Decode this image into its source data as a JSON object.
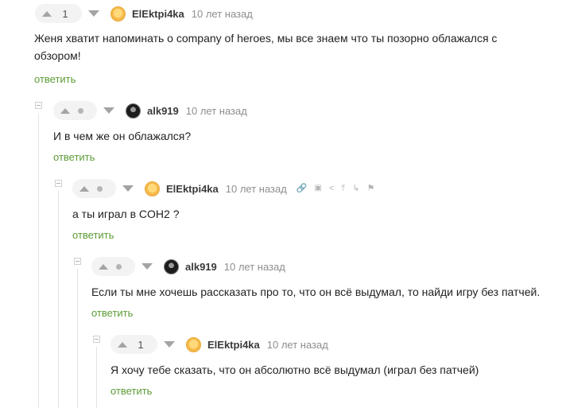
{
  "comments": [
    {
      "author": "ElEktpi4ka",
      "time": "10 лет назад",
      "rating": "1",
      "text": "Женя хватит напоминать о company of heroes, мы все знаем что ты позорно облажался с обзором!",
      "reply": "ответить",
      "avatar": "orange-avatar"
    },
    {
      "author": "alk919",
      "time": "10 лет назад",
      "rating": "",
      "text": "И в чем же он облажался?",
      "reply": "ответить",
      "avatar": "dark-avatar"
    },
    {
      "author": "ElEktpi4ka",
      "time": "10 лет назад",
      "rating": "",
      "text": "а ты играл в COH2 ?",
      "reply": "ответить",
      "avatar": "orange-avatar",
      "actions": [
        "link-icon",
        "save-icon",
        "share-icon",
        "pin-up-icon",
        "hide-icon",
        "report-flag-icon"
      ]
    },
    {
      "author": "alk919",
      "time": "10 лет назад",
      "rating": "",
      "text": "Если ты мне хочешь рассказать про то, что он всё выдумал, то найди игру без патчей.",
      "reply": "ответить",
      "avatar": "dark-avatar"
    },
    {
      "author": "ElEktpi4ka",
      "time": "10 лет назад",
      "rating": "1",
      "text": "Я хочу тебе сказать, что он абсолютно всё выдумал (играл без патчей)",
      "reply": "ответить",
      "avatar": "orange-avatar"
    }
  ],
  "colors": {
    "reply_link": "#5c9c36",
    "rating_bg": "#f3f3f3",
    "thread_line": "#e4e4e4"
  }
}
